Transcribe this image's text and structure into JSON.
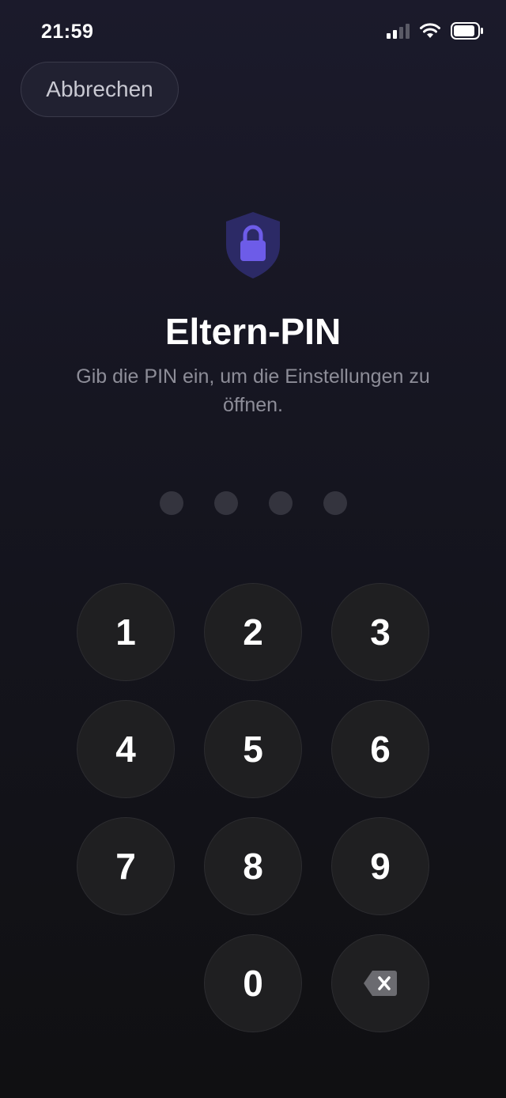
{
  "status_bar": {
    "time": "21:59"
  },
  "header": {
    "cancel_label": "Abbrechen"
  },
  "main": {
    "title": "Eltern-PIN",
    "subtitle": "Gib die PIN ein, um die Einstellungen zu öffnen.",
    "pin_length": 4,
    "pin_entered": 0
  },
  "keypad": {
    "keys": [
      "1",
      "2",
      "3",
      "4",
      "5",
      "6",
      "7",
      "8",
      "9",
      "0"
    ],
    "delete_icon": "backspace-icon"
  },
  "colors": {
    "accent": "#6d5ce8",
    "shield": "#2c2a66",
    "background_top": "#1b1a2b",
    "background_bottom": "#101012"
  }
}
